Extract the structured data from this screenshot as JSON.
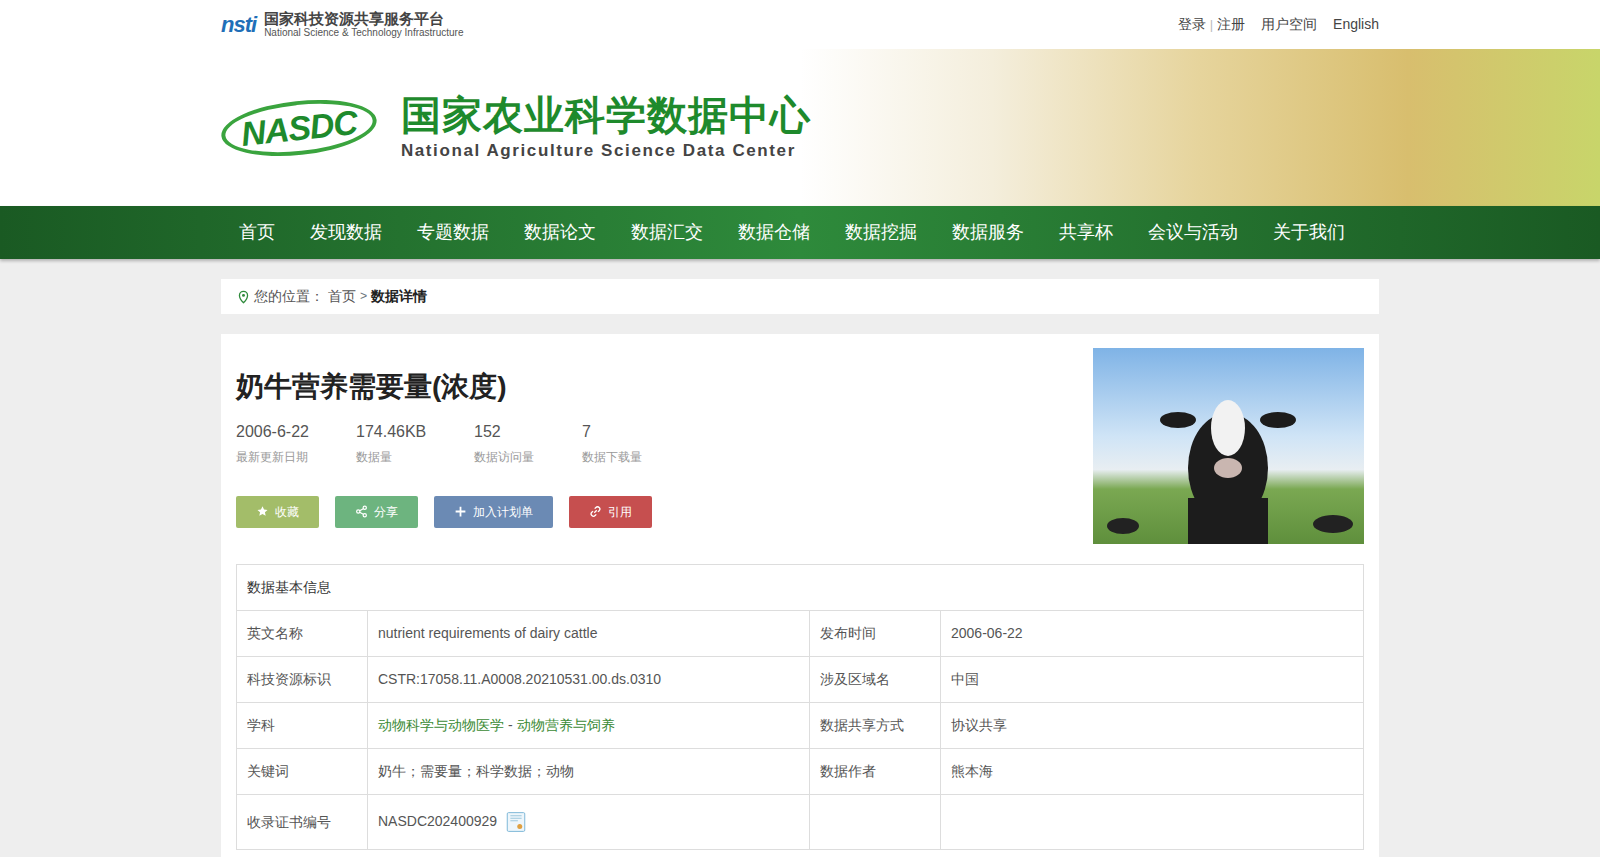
{
  "topbar": {
    "logo_mark": "nsti",
    "logo_cn": "国家科技资源共享服务平台",
    "logo_en": "National Science & Technology Infrastructure",
    "links": [
      {
        "label": "登录",
        "separator_after": true
      },
      {
        "label": "注册",
        "separator_after": false
      },
      {
        "label": "用户空间",
        "separator_after": false
      },
      {
        "label": "English",
        "separator_after": false
      }
    ],
    "separator": "|"
  },
  "banner": {
    "logo": "NASDC",
    "title": "国家农业科学数据中心",
    "subtitle": "National Agriculture Science Data Center"
  },
  "nav": [
    {
      "label": "首页",
      "selected": false
    },
    {
      "label": "发现数据",
      "selected": false
    },
    {
      "label": "专题数据",
      "selected": false
    },
    {
      "label": "数据论文",
      "selected": false
    },
    {
      "label": "数据汇交",
      "selected": false
    },
    {
      "label": "数据仓储",
      "selected": false
    },
    {
      "label": "数据挖掘",
      "selected": false
    },
    {
      "label": "数据服务",
      "selected": false
    },
    {
      "label": "共享杯",
      "selected": false
    },
    {
      "label": "会议与活动",
      "selected": false
    },
    {
      "label": "关于我们",
      "selected": false
    }
  ],
  "breadcrumb": {
    "prefix": "您的位置：",
    "items": [
      "首页",
      "数据详情"
    ],
    "separator": ">"
  },
  "dataset": {
    "title": "奶牛营养需要量(浓度)",
    "stats": [
      {
        "value": "2006-6-22",
        "label": "最新更新日期"
      },
      {
        "value": "174.46KB",
        "label": "数据量"
      },
      {
        "value": "152",
        "label": "数据访问量"
      },
      {
        "value": "7",
        "label": "数据下载量"
      }
    ],
    "buttons": [
      {
        "label": "收藏",
        "icon": "star",
        "color": "#a3bd69"
      },
      {
        "label": "分享",
        "icon": "share",
        "color": "#6db47f"
      },
      {
        "label": "加入计划单",
        "icon": "plus",
        "color": "#6b8ab4"
      },
      {
        "label": "引用",
        "icon": "link",
        "color": "#c64f4f"
      }
    ]
  },
  "table": {
    "title": "数据基本信息",
    "rows": [
      [
        {
          "kind": "text",
          "label": "英文名称",
          "value": "nutrient requirements of dairy cattle"
        },
        {
          "kind": "text",
          "label": "发布时间",
          "value": "2006-06-22"
        }
      ],
      [
        {
          "kind": "text",
          "label": "科技资源标识",
          "value": "CSTR:17058.11.A0008.20210531.00.ds.0310"
        },
        {
          "kind": "text",
          "label": "涉及区域名",
          "value": "中国"
        }
      ],
      [
        {
          "kind": "links",
          "label": "学科",
          "links": [
            "动物科学与动物医学",
            "动物营养与饲养"
          ],
          "separator": "-"
        },
        {
          "kind": "text",
          "label": "数据共享方式",
          "value": "协议共享"
        }
      ],
      [
        {
          "kind": "text",
          "label": "关键词",
          "value": "奶牛；需要量；科学数据；动物"
        },
        {
          "kind": "text",
          "label": "数据作者",
          "value": "熊本海"
        }
      ],
      [
        {
          "kind": "certificate",
          "label": "收录证书编号",
          "value": "NASDC202400929"
        },
        {
          "kind": "empty",
          "label": "",
          "value": ""
        }
      ]
    ]
  }
}
